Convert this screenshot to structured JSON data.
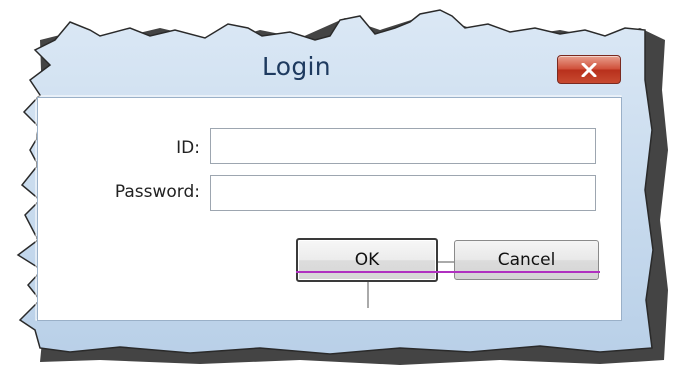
{
  "window": {
    "title": "Login",
    "close_icon": "close-icon"
  },
  "form": {
    "id_label": "ID:",
    "id_value": "",
    "password_label": "Password:",
    "password_value": ""
  },
  "buttons": {
    "ok_label": "OK",
    "cancel_label": "Cancel"
  },
  "colors": {
    "frame": "#b9d1ea",
    "title_text": "#1e3a5f",
    "close_button": "#c8442e",
    "annotation_line": "#b030c0"
  }
}
